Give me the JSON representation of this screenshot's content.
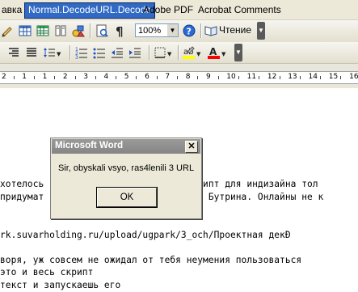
{
  "menubar": {
    "items": [
      {
        "label": "авка"
      },
      {
        "label": "Normal.DecodeURL.Decode"
      },
      {
        "label": "Adobe PDF"
      },
      {
        "label": "Acrobat Comments"
      }
    ]
  },
  "toolbar1": {
    "zoom_value": "100%",
    "read_button_label": "Чтение"
  },
  "toolbar2": {
    "highlight_color": "#ffff00",
    "font_color": "#ff0000"
  },
  "ruler": {
    "numbers": [
      "2",
      "1",
      "1",
      "2",
      "3",
      "4",
      "5",
      "6",
      "7",
      "8",
      "9",
      "10",
      "11",
      "12",
      "13",
      "14",
      "15",
      "16"
    ]
  },
  "document": {
    "lines": [
      "хотелось                          скрипт для индизайна тол",
      "придумат                          ику Бутрина. Онлайны не к",
      "",
      "rk.suvarholding.ru/upload/ugpark/3_och/Проектная декÐ",
      "",
      "воря, уж совсем не ожидал от тебя неумения пользоваться",
      "это и весь скрипт",
      "текст и запускаешь его"
    ]
  },
  "dialog": {
    "title": "Microsoft Word",
    "close_glyph": "✕",
    "message": "Sir, obyskali vsyo, ras4lenili 3 URL",
    "ok_label": "OK"
  }
}
